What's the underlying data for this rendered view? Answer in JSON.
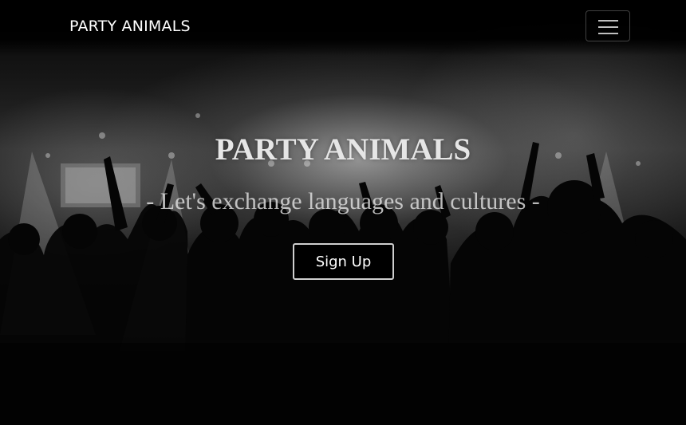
{
  "navbar": {
    "brand": "PARTY ANIMALS",
    "menu_toggle_icon": "hamburger-menu-icon"
  },
  "hero": {
    "title": "PARTY ANIMALS",
    "tagline": "- Let's exchange languages and cultures -",
    "cta_label": "Sign Up",
    "background_image": "concert-crowd-silhouette-photo"
  },
  "colors": {
    "background": "#000000",
    "text": "#ffffff",
    "button_border": "#cfcfcf"
  }
}
